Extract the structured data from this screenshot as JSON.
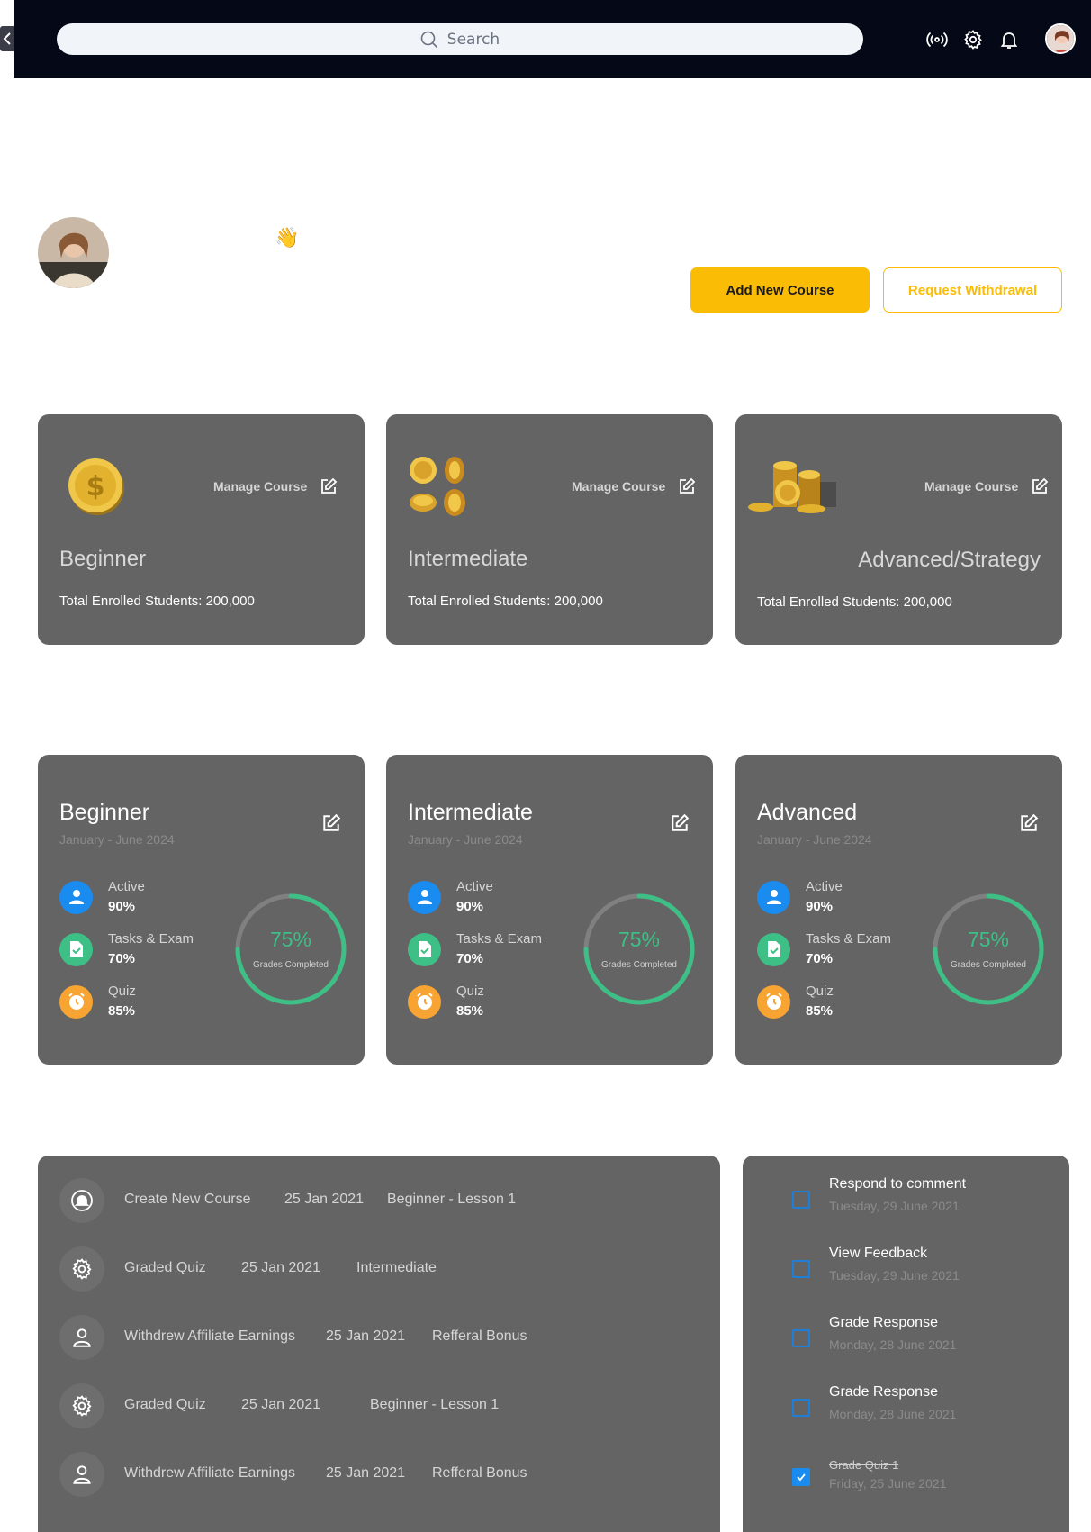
{
  "header": {
    "search_placeholder": "Search"
  },
  "actions": {
    "add_course": "Add New Course",
    "withdraw": "Request Withdrawal"
  },
  "course_cards": [
    {
      "title": "Beginner",
      "manage": "Manage Course",
      "enrolled": "Total Enrolled Students: 200,000"
    },
    {
      "title": "Intermediate",
      "manage": "Manage Course",
      "enrolled": "Total Enrolled Students: 200,000"
    },
    {
      "title": "Advanced/Strategy",
      "manage": "Manage Course",
      "enrolled": "Total Enrolled Students: 200,000"
    }
  ],
  "progress_cards": [
    {
      "title": "Beginner",
      "period": "January - June 2024",
      "active_label": "Active",
      "active": "90%",
      "tasks_label": "Tasks & Exam",
      "tasks": "70%",
      "quiz_label": "Quiz",
      "quiz": "85%",
      "ring_pct": "75%",
      "ring_label": "Grades Completed",
      "ring_fraction": 0.75
    },
    {
      "title": "Intermediate",
      "period": "January - June 2024",
      "active_label": "Active",
      "active": "90%",
      "tasks_label": "Tasks & Exam",
      "tasks": "70%",
      "quiz_label": "Quiz",
      "quiz": "85%",
      "ring_pct": "75%",
      "ring_label": "Grades Completed",
      "ring_fraction": 0.75
    },
    {
      "title": "Advanced",
      "period": "January - June 2024",
      "active_label": "Active",
      "active": "90%",
      "tasks_label": "Tasks & Exam",
      "tasks": "70%",
      "quiz_label": "Quiz",
      "quiz": "85%",
      "ring_pct": "75%",
      "ring_label": "Grades Completed",
      "ring_fraction": 0.75
    }
  ],
  "activity": [
    {
      "icon": "bell-icon",
      "action": "Create New Course",
      "date": "25 Jan 2021",
      "detail": "Beginner - Lesson 1"
    },
    {
      "icon": "gear-icon",
      "action": "Graded Quiz",
      "date": "25 Jan 2021",
      "detail": "Intermediate"
    },
    {
      "icon": "user-icon",
      "action": "Withdrew Affiliate Earnings",
      "date": "25 Jan 2021",
      "detail": "Refferal Bonus"
    },
    {
      "icon": "gear-icon",
      "action": "Graded Quiz",
      "date": "25 Jan 2021",
      "detail": "Beginner - Lesson 1"
    },
    {
      "icon": "user-icon",
      "action": "Withdrew Affiliate Earnings",
      "date": "25 Jan 2021",
      "detail": "Refferal Bonus"
    }
  ],
  "tasks": [
    {
      "title": "Respond to comment",
      "date": "Tuesday, 29 June 2021",
      "done": false
    },
    {
      "title": "View Feedback",
      "date": "Tuesday, 29 June 2021",
      "done": false
    },
    {
      "title": "Grade Response",
      "date": "Monday, 28 June 2021",
      "done": false
    },
    {
      "title": "Grade Response",
      "date": "Monday, 28 June 2021",
      "done": false
    },
    {
      "title": "Grade Quiz 1",
      "date": "Friday, 25 June 2021",
      "done": true
    }
  ],
  "colors": {
    "accent": "#fbbc05",
    "card": "#646464",
    "topbar": "#050816",
    "ring": "#3dbf86",
    "checkbox": "#1a8cf0"
  }
}
